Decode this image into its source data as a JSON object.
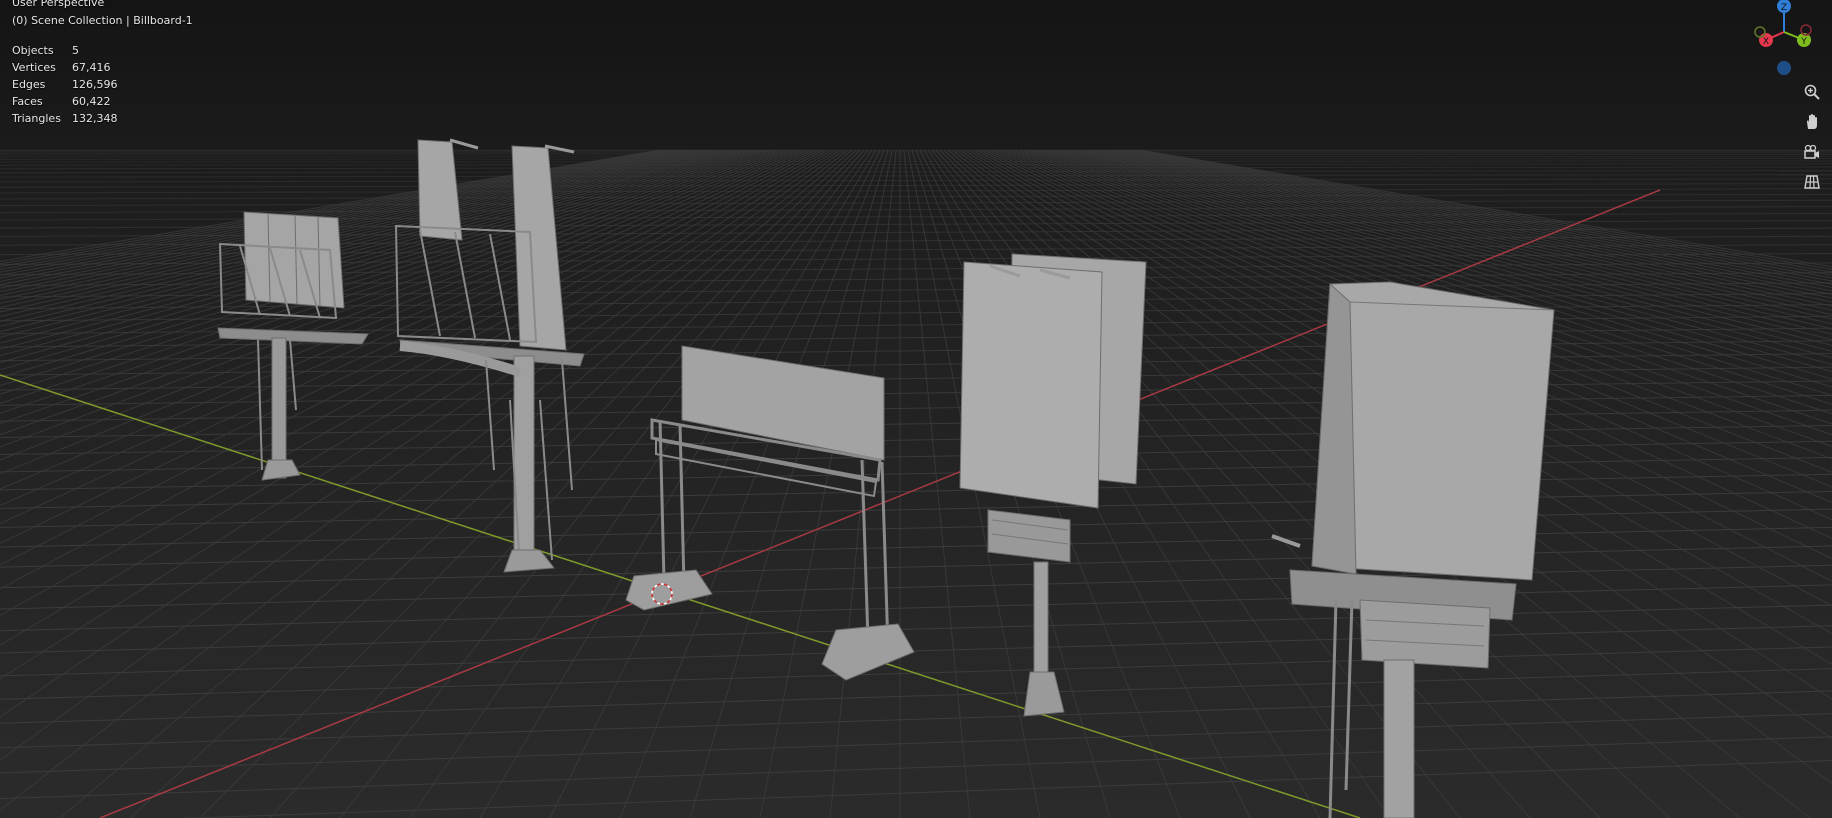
{
  "header": {
    "view_name": "User Perspective",
    "scene_info": "(0) Scene Collection | Billboard-1"
  },
  "stats": [
    {
      "label": "Objects",
      "value": "5"
    },
    {
      "label": "Vertices",
      "value": "67,416"
    },
    {
      "label": "Edges",
      "value": "126,596"
    },
    {
      "label": "Faces",
      "value": "60,422"
    },
    {
      "label": "Triangles",
      "value": "132,348"
    }
  ],
  "gizmo": {
    "z_label": "Z",
    "x_label": "X",
    "y_label": "Y",
    "colors": {
      "x": "#e5374d",
      "y": "#7fbd1f",
      "z": "#2f7ed8"
    }
  },
  "tools": [
    {
      "icon": "zoom-icon"
    },
    {
      "icon": "hand-pan-icon"
    },
    {
      "icon": "camera-view-icon"
    },
    {
      "icon": "grid-ortho-icon"
    }
  ],
  "scene": {
    "objects": [
      "billboard-triple-panel",
      "billboard-double-tall",
      "billboard-gantry",
      "billboard-double-square",
      "billboard-triangular"
    ]
  }
}
